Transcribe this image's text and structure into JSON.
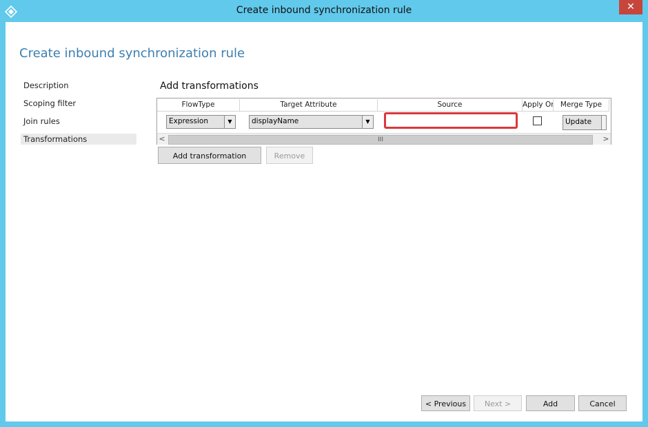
{
  "window": {
    "title": "Create inbound synchronization rule",
    "close_glyph": "✕"
  },
  "page": {
    "title": "Create inbound synchronization rule"
  },
  "nav": {
    "items": [
      "Description",
      "Scoping filter",
      "Join rules",
      "Transformations"
    ],
    "active_index": 3
  },
  "section": {
    "title": "Add transformations"
  },
  "grid": {
    "columns": [
      "FlowType",
      "Target Attribute",
      "Source",
      "Apply Once",
      "Merge Type"
    ],
    "row": {
      "flow_type": "Expression",
      "target_attribute": "displayName",
      "source": "",
      "apply_once": false,
      "merge_type": "Update"
    },
    "scroll_left": "<",
    "scroll_right": ">",
    "scroll_grip": "III"
  },
  "actions": {
    "add_transformation": "Add transformation",
    "remove": "Remove"
  },
  "footer": {
    "previous": "< Previous",
    "next": "Next >",
    "add": "Add",
    "cancel": "Cancel"
  },
  "colors": {
    "titlebar": "#61c9ec",
    "page_title": "#3c7fb1",
    "highlight": "#d9373d",
    "close": "#c7463c"
  }
}
